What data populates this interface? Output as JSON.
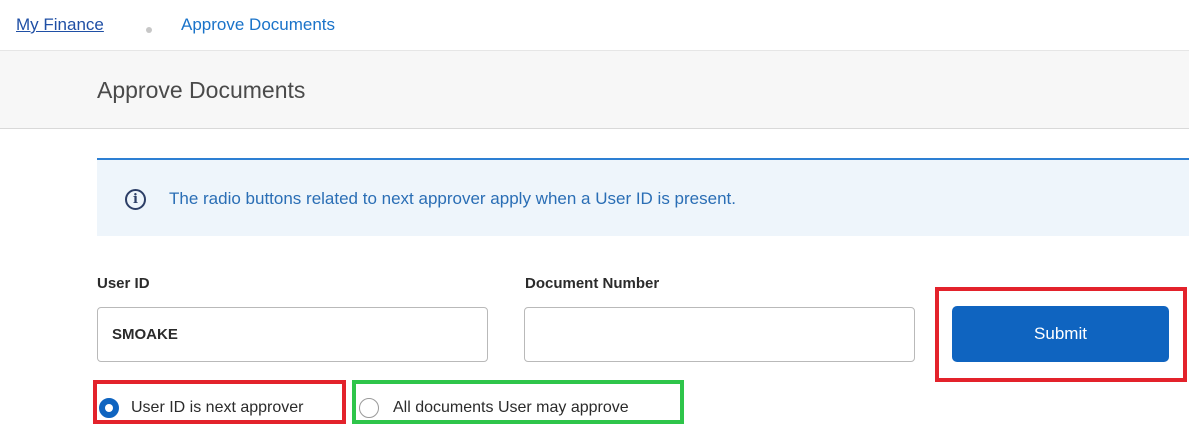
{
  "breadcrumb": {
    "home_label": "My Finance",
    "current_label": "Approve Documents"
  },
  "page": {
    "title": "Approve Documents"
  },
  "info_banner": {
    "icon": "info-icon",
    "message": "The radio buttons related to next approver apply when a User ID is present."
  },
  "form": {
    "user_id_label": "User ID",
    "user_id_value": "SMOAKE",
    "document_number_label": "Document Number",
    "document_number_value": "",
    "submit_label": "Submit",
    "radio_options": [
      {
        "label": "User ID is next approver",
        "checked": true,
        "highlight": "#e3222b"
      },
      {
        "label": "All documents User may approve",
        "checked": false,
        "highlight": "#2ec54a"
      }
    ]
  },
  "colors": {
    "accent": "#0f64c0",
    "link": "#1f4fa5",
    "highlight_red": "#e3222b",
    "highlight_green": "#2ec54a"
  }
}
